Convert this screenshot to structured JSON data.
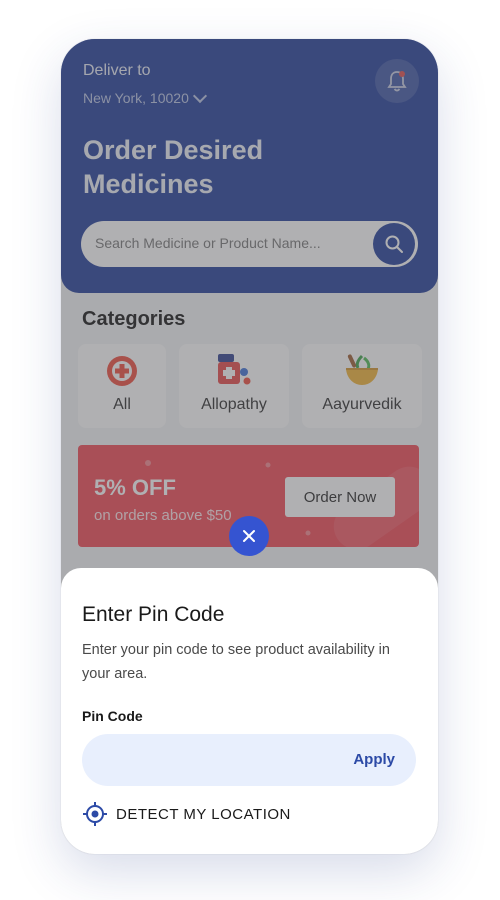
{
  "header": {
    "deliver_label": "Deliver to",
    "location": "New York, 10020",
    "title": "Order Desired Medicines"
  },
  "search": {
    "placeholder": "Search Medicine or Product Name..."
  },
  "categories": {
    "title": "Categories",
    "items": [
      {
        "label": "All",
        "icon": "plus-circle-icon"
      },
      {
        "label": "Allopathy",
        "icon": "medicine-box-icon"
      },
      {
        "label": "Aayurvedik",
        "icon": "herbal-bowl-icon"
      }
    ]
  },
  "banner": {
    "offer": "5% OFF",
    "subtitle": "on orders above $50",
    "button_label": "Order Now"
  },
  "sheet": {
    "title": "Enter Pin Code",
    "description": "Enter your pin code to see product availability in your area.",
    "pin_label": "Pin Code",
    "pin_value": "",
    "apply_label": "Apply",
    "detect_label": "DETECT MY LOCATION"
  },
  "colors": {
    "primary": "#1e3a98",
    "close_button": "#3554d1",
    "banner": "#f24552",
    "input_bg": "#e8effd"
  }
}
